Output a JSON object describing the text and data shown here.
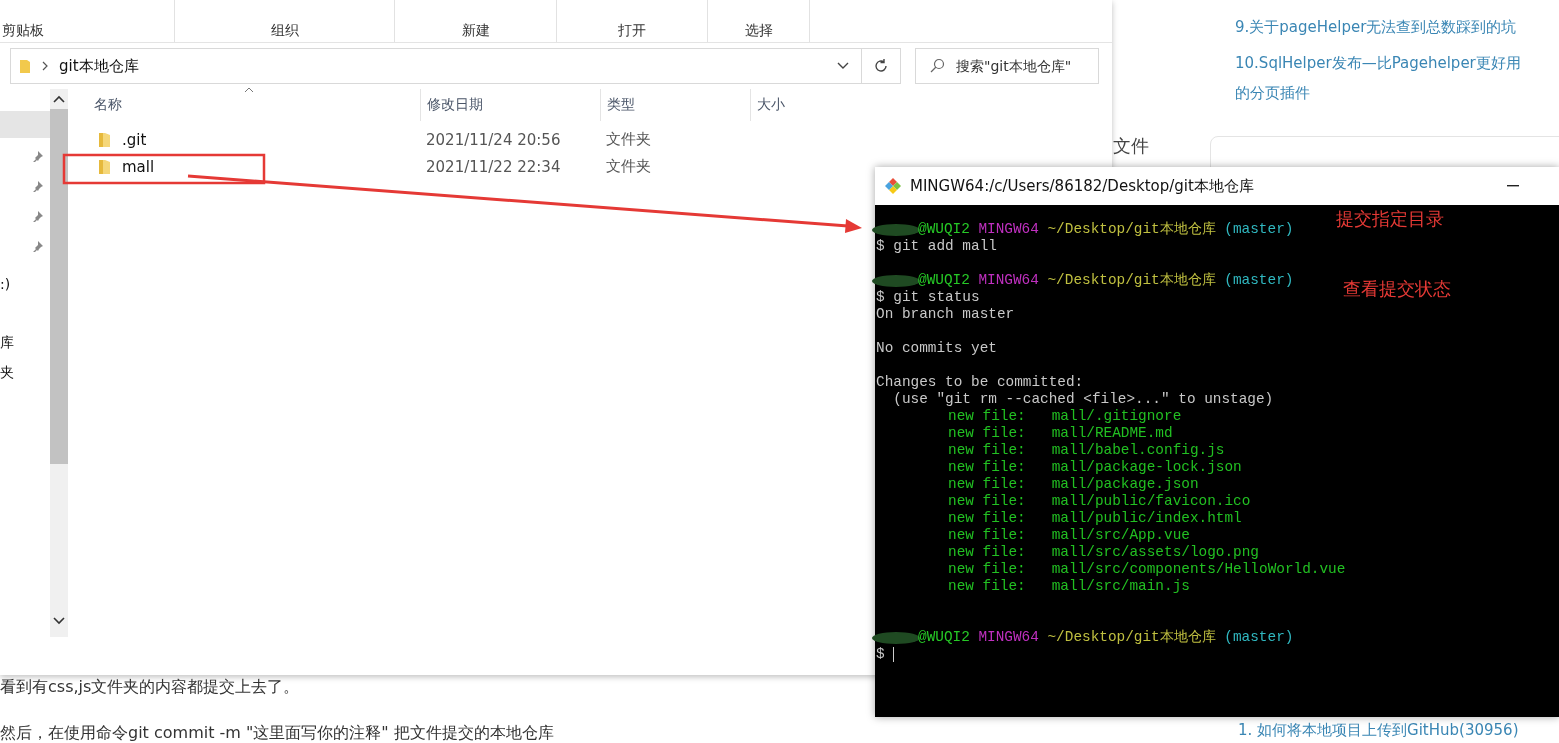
{
  "blog": {
    "links": [
      "9.关于pageHelper无法查到总数踩到的坑",
      "10.SqlHelper发布—比Pagehelper更好用的分页插件"
    ],
    "side_word": "文件",
    "paragraphs": [
      "看到有css,js文件夹的内容都提交上去了。",
      "然后，在使用命令git commit -m \"这里面写你的注释\"  把文件提交的本地仓库"
    ],
    "related_link": "1. 如何将本地项目上传到GitHub(30956)"
  },
  "explorer": {
    "ribbon_groups": [
      "剪贴板",
      "组织",
      "新建",
      "打开",
      "选择"
    ],
    "address": {
      "path": "git本地仓库"
    },
    "search": {
      "placeholder": "搜索\"git本地仓库\""
    },
    "nav_items": [
      {
        "pinned": false,
        "selected": true
      },
      {
        "pinned": true,
        "selected": false
      },
      {
        "pinned": true,
        "selected": false
      },
      {
        "pinned": true,
        "selected": false
      },
      {
        "pinned": true,
        "selected": false
      },
      {
        "label": ":)",
        "pinned": false,
        "selected": false
      },
      {
        "label": "库",
        "pinned": false,
        "selected": false
      },
      {
        "label": "夹",
        "pinned": false,
        "selected": false
      }
    ],
    "columns": [
      "名称",
      "修改日期",
      "类型",
      "大小"
    ],
    "rows": [
      {
        "name": ".git",
        "modified": "2021/11/24 20:56",
        "type": "文件夹"
      },
      {
        "name": "mall",
        "modified": "2021/11/22 22:34",
        "type": "文件夹"
      }
    ]
  },
  "terminal": {
    "title": "MINGW64:/c/Users/86182/Desktop/git本地仓库",
    "lines": [
      {
        "kind": "prompt",
        "user": "@WUQI2",
        "shell": "MINGW64",
        "path": "~/Desktop/git本地仓库",
        "branch": "(master)"
      },
      {
        "kind": "output",
        "text": "$ git add mall"
      },
      {
        "kind": "blank"
      },
      {
        "kind": "prompt",
        "user": "@WUQI2",
        "shell": "MINGW64",
        "path": "~/Desktop/git本地仓库",
        "branch": "(master)"
      },
      {
        "kind": "output",
        "text": "$ git status"
      },
      {
        "kind": "output",
        "text": "On branch master"
      },
      {
        "kind": "blank"
      },
      {
        "kind": "output",
        "text": "No commits yet"
      },
      {
        "kind": "blank"
      },
      {
        "kind": "output",
        "text": "Changes to be committed:"
      },
      {
        "kind": "output",
        "text": "  (use \"git rm --cached <file>...\" to unstage)"
      },
      {
        "kind": "staged",
        "label": "new file:",
        "path": "mall/.gitignore"
      },
      {
        "kind": "staged",
        "label": "new file:",
        "path": "mall/README.md"
      },
      {
        "kind": "staged",
        "label": "new file:",
        "path": "mall/babel.config.js"
      },
      {
        "kind": "staged",
        "label": "new file:",
        "path": "mall/package-lock.json"
      },
      {
        "kind": "staged",
        "label": "new file:",
        "path": "mall/package.json"
      },
      {
        "kind": "staged",
        "label": "new file:",
        "path": "mall/public/favicon.ico"
      },
      {
        "kind": "staged",
        "label": "new file:",
        "path": "mall/public/index.html"
      },
      {
        "kind": "staged",
        "label": "new file:",
        "path": "mall/src/App.vue"
      },
      {
        "kind": "staged",
        "label": "new file:",
        "path": "mall/src/assets/logo.png"
      },
      {
        "kind": "staged",
        "label": "new file:",
        "path": "mall/src/components/HelloWorld.vue"
      },
      {
        "kind": "staged",
        "label": "new file:",
        "path": "mall/src/main.js"
      },
      {
        "kind": "blank"
      },
      {
        "kind": "blank"
      },
      {
        "kind": "prompt",
        "user": "@WUQI2",
        "shell": "MINGW64",
        "path": "~/Desktop/git本地仓库",
        "branch": "(master)"
      },
      {
        "kind": "input",
        "text": "$"
      }
    ]
  },
  "annotations": [
    "提交指定目录",
    "查看提交状态"
  ]
}
